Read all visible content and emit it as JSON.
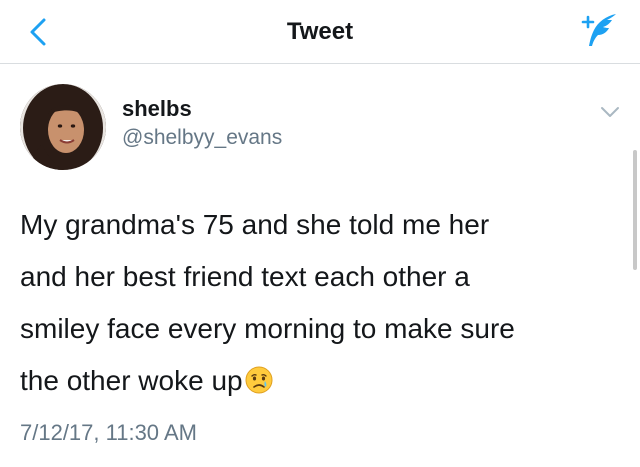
{
  "nav": {
    "title": "Tweet",
    "back_icon": "chevron-left-icon",
    "compose_icon": "compose-tweet-icon",
    "accent": "#1da1f2"
  },
  "tweet": {
    "display_name": "shelbs",
    "handle": "@shelbyy_evans",
    "text_lines": [
      "My grandma's 75 and she told me her",
      "and her best friend text each other a",
      "smiley face every morning to make sure",
      "the other woke up"
    ],
    "emoji": "crying-face-emoji",
    "timestamp": "7/12/17, 11:30 AM",
    "caret_icon": "chevron-down-icon"
  },
  "colors": {
    "text": "#14171a",
    "secondary": "#657786",
    "divider": "#d9dde0"
  }
}
